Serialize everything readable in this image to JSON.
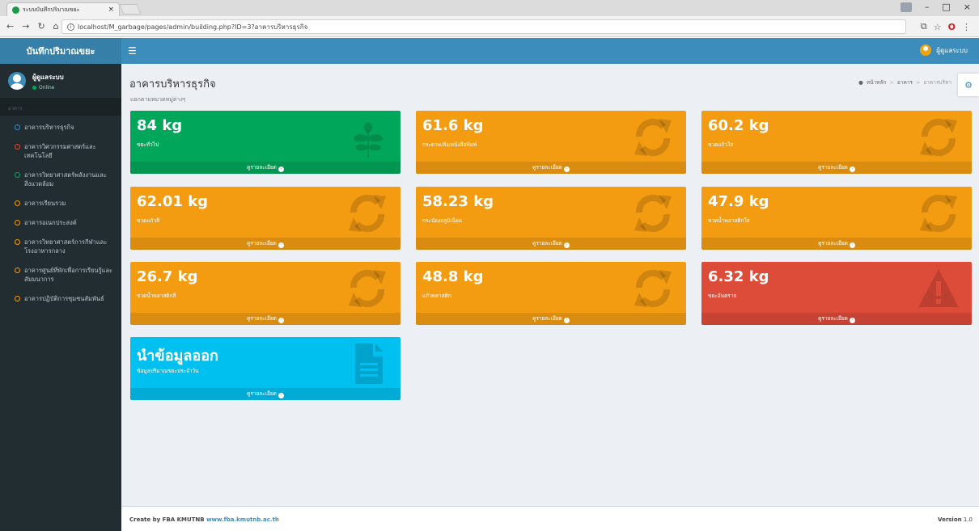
{
  "browser": {
    "tab_title": "ระบบบันทึกปริมาณขยะ",
    "tab_close": "×",
    "url": "localhost/M_garbage/pages/admin/building.php?ID=3?อาคารบริหารธุรกิจ",
    "controls": {
      "minimize": "–",
      "maximize": "□",
      "close": "×"
    }
  },
  "header": {
    "logo": "บันทึกปริมาณขยะ",
    "user": "ผู้ดูแลระบบ"
  },
  "sidebar": {
    "user_name": "ผู้ดูแลระบบ",
    "status": "Online",
    "section": "อาคาร",
    "items": [
      {
        "label": "อาคารบริหารธุรกิจ",
        "color": "#3c8dbc"
      },
      {
        "label": "อาคารวิศวกรรมศาสตร์และเทคโนโลยี",
        "color": "#dd4b39"
      },
      {
        "label": "อาคารวิทยาศาสตร์พลังงานและสิ่งแวดล้อม",
        "color": "#00a65a"
      },
      {
        "label": "อาคารเรียนรวม",
        "color": "#f39c12"
      },
      {
        "label": "อาคารอเนกประสงค์",
        "color": "#f39c12"
      },
      {
        "label": "อาคารวิทยาศาสตร์การกีฬาและโรงอาหารกลาง",
        "color": "#f39c12"
      },
      {
        "label": "อาคารศูนย์ที่พักเพื่อการเรียนรู้และสัมมนาการ",
        "color": "#f39c12"
      },
      {
        "label": "อาคารปฏิบัติการชุมชนสัมพันธ์",
        "color": "#f39c12"
      }
    ]
  },
  "page": {
    "title": "อาคารบริหารธุรกิจ",
    "subtitle": "แยกตามหมวดหมู่ต่างๆ",
    "breadcrumb": [
      "หน้าหลัก",
      "อาคาร",
      "อาคารบริหา"
    ]
  },
  "cards": [
    {
      "value": "84 kg",
      "label": "ขยะทั่วไป",
      "color": "green",
      "icon": "leaf-icon",
      "more": "ดูรายละเอียด"
    },
    {
      "value": "61.6 kg",
      "label": "กระดาษ/ลัง/หนังสือพิมพ์",
      "color": "orange",
      "icon": "recycle-icon",
      "more": "ดูรายละเอียด"
    },
    {
      "value": "60.2 kg",
      "label": "ขวดแก้วใส",
      "color": "orange",
      "icon": "recycle-icon",
      "more": "ดูรายละเอียด"
    },
    {
      "value": "62.01 kg",
      "label": "ขวดแก้วสี",
      "color": "orange",
      "icon": "recycle-icon",
      "more": "ดูรายละเอียด"
    },
    {
      "value": "58.23 kg",
      "label": "กระป๋องอลูมิเนียม",
      "color": "orange",
      "icon": "recycle-icon",
      "more": "ดูรายละเอียด"
    },
    {
      "value": "47.9 kg",
      "label": "ขวดน้ำพลาสติกใส",
      "color": "orange",
      "icon": "recycle-icon",
      "more": "ดูรายละเอียด"
    },
    {
      "value": "26.7 kg",
      "label": "ขวดน้ำพลาสติกสี",
      "color": "orange",
      "icon": "recycle-icon",
      "more": "ดูรายละเอียด"
    },
    {
      "value": "48.8 kg",
      "label": "แก้วพลาสติก",
      "color": "orange",
      "icon": "recycle-icon",
      "more": "ดูรายละเอียด"
    },
    {
      "value": "6.32 kg",
      "label": "ขยะอันตราย",
      "color": "red",
      "icon": "warning-icon",
      "more": "ดูรายละเอียด"
    },
    {
      "value": "นำข้อมูลออก",
      "label": "ข้อมูลปริมาณขยะประจำวัน",
      "color": "aqua",
      "icon": "document-icon",
      "more": "ดูรายละเอียด"
    }
  ],
  "footer": {
    "create_by": "Create by FBA KMUTNB",
    "link": "www.fba.kmutnb.ac.th",
    "version_label": "Version",
    "version": "1.0"
  }
}
